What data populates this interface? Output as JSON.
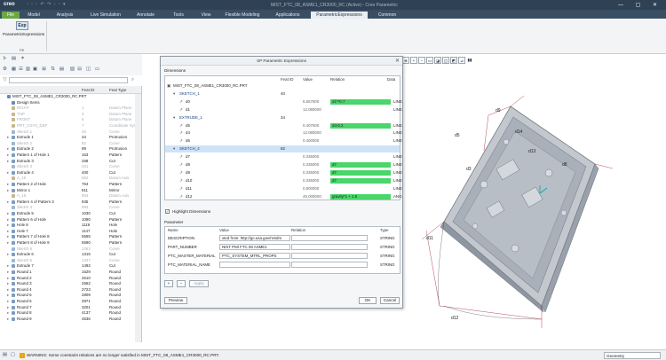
{
  "app": {
    "logo": "creo",
    "window_title": "MIST_FTC_08_ASME1_CR3000_RC (Active) - Creo Parametric",
    "win_buttons": "— ▢ ✕"
  },
  "ribbon": {
    "tabs": [
      "File",
      "Model",
      "Analysis",
      "Live Simulation",
      "Annotate",
      "Tools",
      "View",
      "Flexible Modeling",
      "Applications",
      "ParametricExpressions",
      "Common"
    ],
    "active_tab": "ParametricExpressions",
    "exp_button_icon": "Exp",
    "exp_button_label": "ParametricExpressions",
    "group_label": "PE"
  },
  "tree": {
    "search_placeholder": "",
    "columns": [
      "",
      "Feat ID",
      "Feat Type"
    ],
    "rows": [
      {
        "name": "MIST_FTC_08_ASME1_CR3000_RC.PRT",
        "id": "",
        "type": "",
        "dim": false,
        "indent": 0,
        "color": "#6c8ab0"
      },
      {
        "name": "Design Items",
        "id": "",
        "type": "",
        "dim": false,
        "indent": 1,
        "color": "#6c8ab0"
      },
      {
        "name": "RIGHT",
        "id": "1",
        "type": "Datum Plane",
        "dim": true,
        "indent": 1,
        "color": "#c9b78a"
      },
      {
        "name": "TOP",
        "id": "3",
        "type": "Datum Plane",
        "dim": true,
        "indent": 1,
        "color": "#c9b78a"
      },
      {
        "name": "FRONT",
        "id": "5",
        "type": "Datum Plane",
        "dim": true,
        "indent": 1,
        "color": "#c9b78a"
      },
      {
        "name": "PRT_CSYS_DEF",
        "id": "7",
        "type": "Coordinate Sys",
        "dim": true,
        "indent": 1,
        "color": "#c9b78a"
      },
      {
        "name": "Sketch 1",
        "id": "40",
        "type": "Curve",
        "dim": true,
        "indent": 1,
        "color": "#9ab8d6"
      },
      {
        "name": "Extrude 1",
        "id": "34",
        "type": "Protrusion",
        "dim": false,
        "indent": 1,
        "color": "#7d9cc2"
      },
      {
        "name": "Sketch 2",
        "id": "82",
        "type": "Curve",
        "dim": true,
        "indent": 1,
        "color": "#9ab8d6"
      },
      {
        "name": "Extrude 2",
        "id": "99",
        "type": "Protrusion",
        "dim": false,
        "indent": 1,
        "color": "#7d9cc2"
      },
      {
        "name": "Pattern 1 of Hole 1",
        "id": "163",
        "type": "Pattern",
        "dim": false,
        "indent": 1,
        "color": "#7d9cc2"
      },
      {
        "name": "Extrude 3",
        "id": "268",
        "type": "Cut",
        "dim": false,
        "indent": 1,
        "color": "#7d9cc2"
      },
      {
        "name": "Sketch 3",
        "id": "331",
        "type": "Curve",
        "dim": true,
        "indent": 1,
        "color": "#9ab8d6"
      },
      {
        "name": "Extrude 4",
        "id": "400",
        "type": "Cut",
        "dim": false,
        "indent": 1,
        "color": "#7d9cc2"
      },
      {
        "name": "A_15",
        "id": "552",
        "type": "Datum Axis",
        "dim": true,
        "indent": 1,
        "color": "#c9b78a"
      },
      {
        "name": "Pattern 2 of Hole",
        "id": "764",
        "type": "Pattern",
        "dim": false,
        "indent": 1,
        "color": "#7d9cc2"
      },
      {
        "name": "Mirror 1",
        "id": "811",
        "type": "Mirror",
        "dim": false,
        "indent": 1,
        "color": "#7d9cc2"
      },
      {
        "name": "A_16",
        "id": "894",
        "type": "Datum Axis",
        "dim": true,
        "indent": 1,
        "color": "#c9b78a"
      },
      {
        "name": "Pattern 4 of Pattern 3",
        "id": "935",
        "type": "Pattern",
        "dim": false,
        "indent": 1,
        "color": "#7d9cc2"
      },
      {
        "name": "Sketch 4",
        "id": "993",
        "type": "Curve",
        "dim": true,
        "indent": 1,
        "color": "#9ab8d6"
      },
      {
        "name": "Extrude 5",
        "id": "1030",
        "type": "Cut",
        "dim": false,
        "indent": 1,
        "color": "#7d9cc2"
      },
      {
        "name": "Pattern 6 of Hole",
        "id": "1090",
        "type": "Pattern",
        "dim": false,
        "indent": 1,
        "color": "#7d9cc2"
      },
      {
        "name": "Hole 8",
        "id": "1119",
        "type": "Hole",
        "dim": false,
        "indent": 1,
        "color": "#7d9cc2"
      },
      {
        "name": "Hole 7",
        "id": "1147",
        "type": "Hole",
        "dim": false,
        "indent": 1,
        "color": "#7d9cc2"
      },
      {
        "name": "Pattern 7 of Hole 8",
        "id": "5555",
        "type": "Pattern",
        "dim": false,
        "indent": 1,
        "color": "#7d9cc2"
      },
      {
        "name": "Pattern 8 of Hole 9",
        "id": "5590",
        "type": "Pattern",
        "dim": false,
        "indent": 1,
        "color": "#7d9cc2"
      },
      {
        "name": "Sketch 5",
        "id": "1262",
        "type": "Curve",
        "dim": true,
        "indent": 1,
        "color": "#9ab8d6"
      },
      {
        "name": "Extrude 6",
        "id": "1315",
        "type": "Cut",
        "dim": false,
        "indent": 1,
        "color": "#7d9cc2"
      },
      {
        "name": "Sketch 6",
        "id": "1337",
        "type": "Curve",
        "dim": true,
        "indent": 1,
        "color": "#9ab8d6"
      },
      {
        "name": "Extrude 7",
        "id": "1492",
        "type": "Cut",
        "dim": false,
        "indent": 1,
        "color": "#7d9cc2"
      },
      {
        "name": "Round 1",
        "id": "1529",
        "type": "Round",
        "dim": false,
        "indent": 1,
        "color": "#7d9cc2"
      },
      {
        "name": "Round 2",
        "id": "2510",
        "type": "Round",
        "dim": false,
        "indent": 1,
        "color": "#7d9cc2"
      },
      {
        "name": "Round 3",
        "id": "2652",
        "type": "Round",
        "dim": false,
        "indent": 1,
        "color": "#7d9cc2"
      },
      {
        "name": "Round 4",
        "id": "2723",
        "type": "Round",
        "dim": false,
        "indent": 1,
        "color": "#7d9cc2"
      },
      {
        "name": "Round 5",
        "id": "2809",
        "type": "Round",
        "dim": false,
        "indent": 1,
        "color": "#7d9cc2"
      },
      {
        "name": "Round 6",
        "id": "2871",
        "type": "Round",
        "dim": false,
        "indent": 1,
        "color": "#7d9cc2"
      },
      {
        "name": "Round 7",
        "id": "3201",
        "type": "Round",
        "dim": false,
        "indent": 1,
        "color": "#7d9cc2"
      },
      {
        "name": "Round 8",
        "id": "4137",
        "type": "Round",
        "dim": false,
        "indent": 1,
        "color": "#7d9cc2"
      },
      {
        "name": "Round 9",
        "id": "4536",
        "type": "Round",
        "dim": false,
        "indent": 1,
        "color": "#7d9cc2"
      }
    ]
  },
  "dialog": {
    "title": "SP Parametric Expressions",
    "close": "✕",
    "dims_label": "Dimensions",
    "dim_cols": [
      "",
      "Feat ID",
      "Value",
      "Relation",
      "Data"
    ],
    "dim_rows": [
      {
        "name": "MIST_FTC_08_ASME1_CR3000_RC.PRT",
        "fid": "",
        "val": "",
        "rel": "",
        "dt": "",
        "green": false,
        "lvl": 0,
        "hl": false
      },
      {
        "name": "SKETCH_1",
        "fid": "40",
        "val": "",
        "rel": "",
        "dt": "",
        "green": false,
        "lvl": 1,
        "hl": false
      },
      {
        "name": "d0",
        "fid": "",
        "val": "5.557600",
        "rel": "d1**0.7",
        "dt": "LINE",
        "green": true,
        "lvl": 2,
        "hl": false
      },
      {
        "name": "d1",
        "fid": "",
        "val": "12.080000",
        "rel": "",
        "dt": "LINE",
        "green": false,
        "lvl": 2,
        "hl": false
      },
      {
        "name": "EXTRUDE_1",
        "fid": "34",
        "val": "",
        "rel": "",
        "dt": "",
        "green": false,
        "lvl": 1,
        "hl": false
      },
      {
        "name": "d5",
        "fid": "",
        "val": "0.407600",
        "rel": "d4-0.2",
        "dt": "LINE",
        "green": true,
        "lvl": 2,
        "hl": false
      },
      {
        "name": "d4",
        "fid": "",
        "val": "12.080000",
        "rel": "",
        "dt": "LINE",
        "green": false,
        "lvl": 2,
        "hl": false
      },
      {
        "name": "d6",
        "fid": "",
        "val": "0.400000",
        "rel": "",
        "dt": "LINE",
        "green": false,
        "lvl": 2,
        "hl": false
      },
      {
        "name": "SKETCH_2",
        "fid": "82",
        "val": "",
        "rel": "",
        "dt": "",
        "green": false,
        "lvl": 1,
        "hl": true
      },
      {
        "name": "d7",
        "fid": "",
        "val": "0.335000",
        "rel": "",
        "dt": "LINE",
        "green": false,
        "lvl": 2,
        "hl": false
      },
      {
        "name": "d8",
        "fid": "",
        "val": "0.335000",
        "rel": "d7",
        "dt": "LINE",
        "green": true,
        "lvl": 2,
        "hl": false
      },
      {
        "name": "d9",
        "fid": "",
        "val": "0.335000",
        "rel": "d7",
        "dt": "LINE",
        "green": true,
        "lvl": 2,
        "hl": false
      },
      {
        "name": "d10",
        "fid": "",
        "val": "0.335000",
        "rel": "d7",
        "dt": "LINE",
        "green": true,
        "lvl": 2,
        "hl": false
      },
      {
        "name": "d11",
        "fid": "",
        "val": "0.800000",
        "rel": "",
        "dt": "LINE",
        "green": false,
        "lvl": 2,
        "hl": false
      },
      {
        "name": "d12",
        "fid": "",
        "val": "45.000000",
        "rel": "gravity*1 + 1.5",
        "dt": "ANG",
        "green": true,
        "lvl": 2,
        "hl": false
      }
    ],
    "highlight_label": "Highlight Dimensions",
    "params_label": "Parameter",
    "param_cols": [
      "Name",
      "Value",
      "Relation",
      "Type"
    ],
    "param_rows": [
      {
        "name": "DESCRIPTION",
        "value": "xted from: http://go.usa.gov/mSdm",
        "type": "STRING"
      },
      {
        "name": "PART_NUMBER",
        "value": "NIST PMI FTC 08 ASME1",
        "type": "STRING"
      },
      {
        "name": "PTC_MASTER_MATERIAL",
        "value": "PTC_SYSTEM_MTRL_PROPS",
        "type": "STRING"
      },
      {
        "name": "PTC_MATERIAL_NAME",
        "value": "",
        "type": "STRING"
      }
    ],
    "add": "+",
    "remove": "−",
    "apply": "Apply",
    "preview": "Preview",
    "ok": "OK",
    "cancel": "Cancel"
  },
  "model": {
    "dim_labels": [
      "d9",
      "d14",
      "d5",
      "d13",
      "d8",
      "d11",
      "d12",
      "d3"
    ]
  },
  "status": {
    "warning": "WARNING: Some constraint relations are no longer satisfied in MIST_FTC_08_ASME1_CR3000_RC.PRT.",
    "filter": "Geometry"
  }
}
